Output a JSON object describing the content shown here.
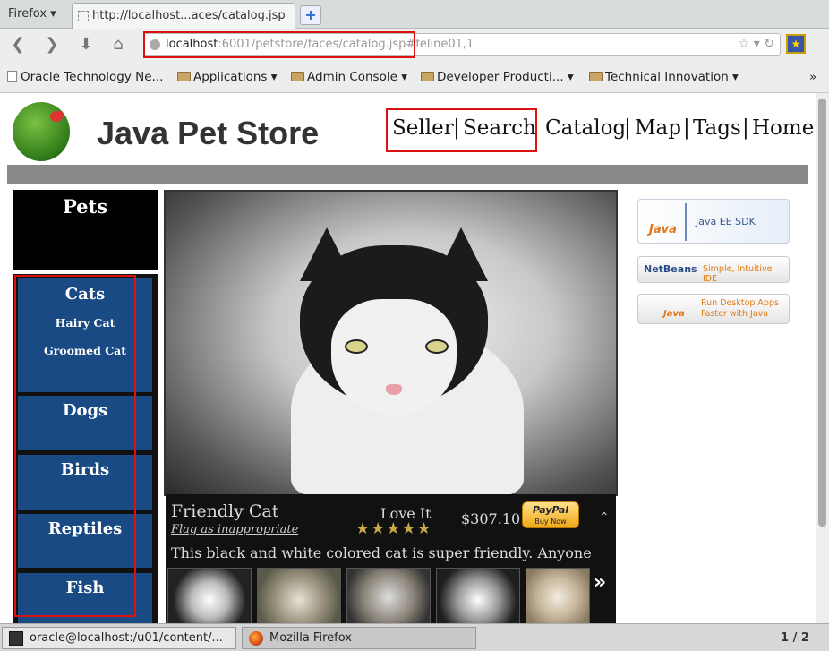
{
  "browser": {
    "menu_label": "Firefox ▾",
    "tab_title": "http://localhost...aces/catalog.jsp",
    "new_tab_label": "+",
    "url_host": "localhost",
    "url_rest": ":6001/petstore/faces/catalog.jsp#feline01,1",
    "url_icons": "☆ ▾ ↻",
    "bookmarks": [
      {
        "label": "Oracle Technology Ne..."
      },
      {
        "label": "Applications ▾"
      },
      {
        "label": "Admin Console ▾"
      },
      {
        "label": "Developer Producti... ▾"
      },
      {
        "label": "Technical Innovation ▾"
      }
    ],
    "bookmarks_overflow": "»"
  },
  "site": {
    "title": "Java Pet Store",
    "nav": {
      "seller": "Seller",
      "sep1": "|",
      "search": "Search",
      "catalog": "Catalog",
      "map": "Map",
      "tags": "Tags",
      "home": "Home",
      "sep": "|"
    },
    "pets_header": "Pets",
    "categories": [
      {
        "name": "Cats",
        "subs": [
          "Hairy Cat",
          "Groomed Cat"
        ]
      },
      {
        "name": "Dogs"
      },
      {
        "name": "Birds"
      },
      {
        "name": "Reptiles"
      },
      {
        "name": "Fish"
      }
    ],
    "product": {
      "name": "Friendly Cat",
      "flag_label": "Flag as inappropriate",
      "love_label": "Love It",
      "rating_stars": "★★★★★",
      "price": "$307.10",
      "paypal_label": "PayPal",
      "paypal_sub": "Buy Now",
      "description": "This black and white colored cat is super friendly. Anyone",
      "more_label": "»",
      "collapse_label": "⌃"
    },
    "ads": [
      {
        "brand": "Java",
        "text": "Java EE SDK"
      },
      {
        "brand": "NetBeans",
        "text": "Simple, Intuitive IDE"
      },
      {
        "brand": "Java",
        "text": "Run Desktop Apps Faster with Java"
      }
    ]
  },
  "taskbar": {
    "tasks": [
      {
        "label": "oracle@localhost:/u01/content/..."
      },
      {
        "label": "Mozilla Firefox"
      }
    ],
    "pager": "1 / 2"
  }
}
